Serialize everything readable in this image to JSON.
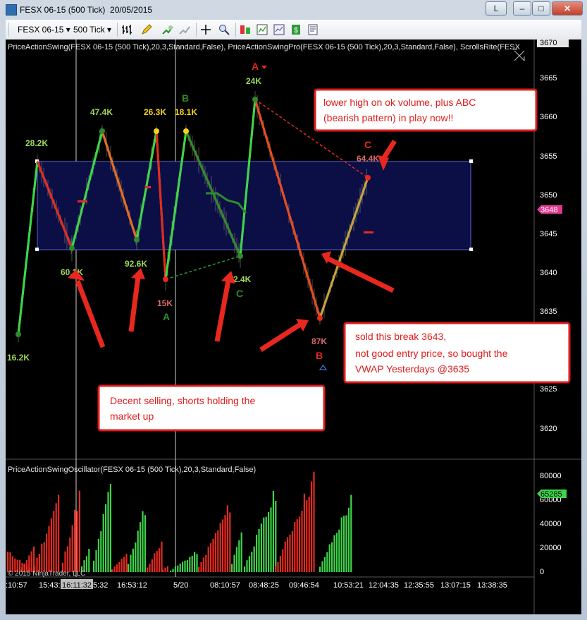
{
  "window": {
    "title": "FESX 06-15 (500 Tick)  20/05/2015",
    "btn_l": "L",
    "btn_min": "–",
    "btn_max": "□",
    "btn_close": "✕"
  },
  "toolbar": {
    "instrument": "FESX 06-15",
    "interval": "500 Tick",
    "icons": [
      "bar-type-icon",
      "pencil-icon",
      "add-indicator-icon",
      "strategy-icon",
      "crosshair-icon",
      "zoom-icon",
      "chart-trader-icon",
      "data-box-icon",
      "properties-icon",
      "money-icon",
      "template-icon"
    ]
  },
  "chart": {
    "indicator_label": "PriceActionSwing(FESX 06-15 (500 Tick),20,3,Standard,False), PriceActionSwingPro(FESX 06-15 (500 Tick),20,3,Standard,False), ScrollsRite(FESX",
    "price_ticks": [
      "3670",
      "3665",
      "3660",
      "3655",
      "3650",
      "3645",
      "3640",
      "3635",
      "3625",
      "3620"
    ],
    "current_price": "3648",
    "swing_labels": [
      "28.2K",
      "47.4K",
      "26.3K",
      "18.1K",
      "24K",
      "64.4K",
      "60.1K",
      "92.6K",
      "15K",
      "2.4K",
      "87K",
      "16.2K"
    ],
    "swing_letters": [
      "A",
      "B",
      "C",
      "A",
      "C",
      "B"
    ],
    "annotations": {
      "top_right": "lower high on ok volume, plus ABC (bearish pattern) in play now!!",
      "bottom_right_1": "sold this break 3643,",
      "bottom_right_2": "not good entry price, so bought the",
      "bottom_right_3": "VWAP Yesterdays @3635",
      "bottom_left_1": "Decent selling, shorts holding the",
      "bottom_left_2": "market up"
    }
  },
  "oscillator": {
    "label": "PriceActionSwingOscillator(FESX 06-15 (500 Tick),20,3,Standard,False)",
    "ticks": [
      "80000",
      "60000",
      "40000",
      "20000",
      "0"
    ],
    "current": "65285",
    "copyright": "© 2015 NinjaTrader, LLC"
  },
  "time_axis": {
    "labels": [
      ":10:57",
      "15:43:",
      "16:11:32",
      "5:32",
      "16:53:12",
      "5/20",
      "08:10:57",
      "08:48:25",
      "09:46:54",
      "10:53:21",
      "12:04:35",
      "12:35:55",
      "13:07:15",
      "13:38:35"
    ]
  },
  "chart_data": {
    "type": "line",
    "title": "FESX 06-15 (500 Tick)",
    "swing_points": [
      {
        "label": "16.2K",
        "price": 3633
      },
      {
        "label": "28.2K",
        "price": 3654
      },
      {
        "label": "60.1K",
        "price": 3643
      },
      {
        "label": "47.4K",
        "price": 3658
      },
      {
        "label": "92.6K",
        "price": 3644
      },
      {
        "label": "26.3K",
        "price": 3658
      },
      {
        "label": "15K",
        "price": 3639
      },
      {
        "label": "18.1K",
        "price": 3658
      },
      {
        "label": "2.4K",
        "price": 3642
      },
      {
        "label": "24K",
        "price": 3662
      },
      {
        "label": "87K",
        "price": 3634
      },
      {
        "label": "64.4K",
        "price": 3652
      }
    ],
    "ylim": [
      3617,
      3671
    ],
    "oscillator_ylim": [
      0,
      85000
    ]
  },
  "colors": {
    "up": "#3fd44a",
    "down": "#e8281e",
    "box": "#0b0f45",
    "annotation_border": "#e01c1c",
    "marker": "#e0388f"
  }
}
